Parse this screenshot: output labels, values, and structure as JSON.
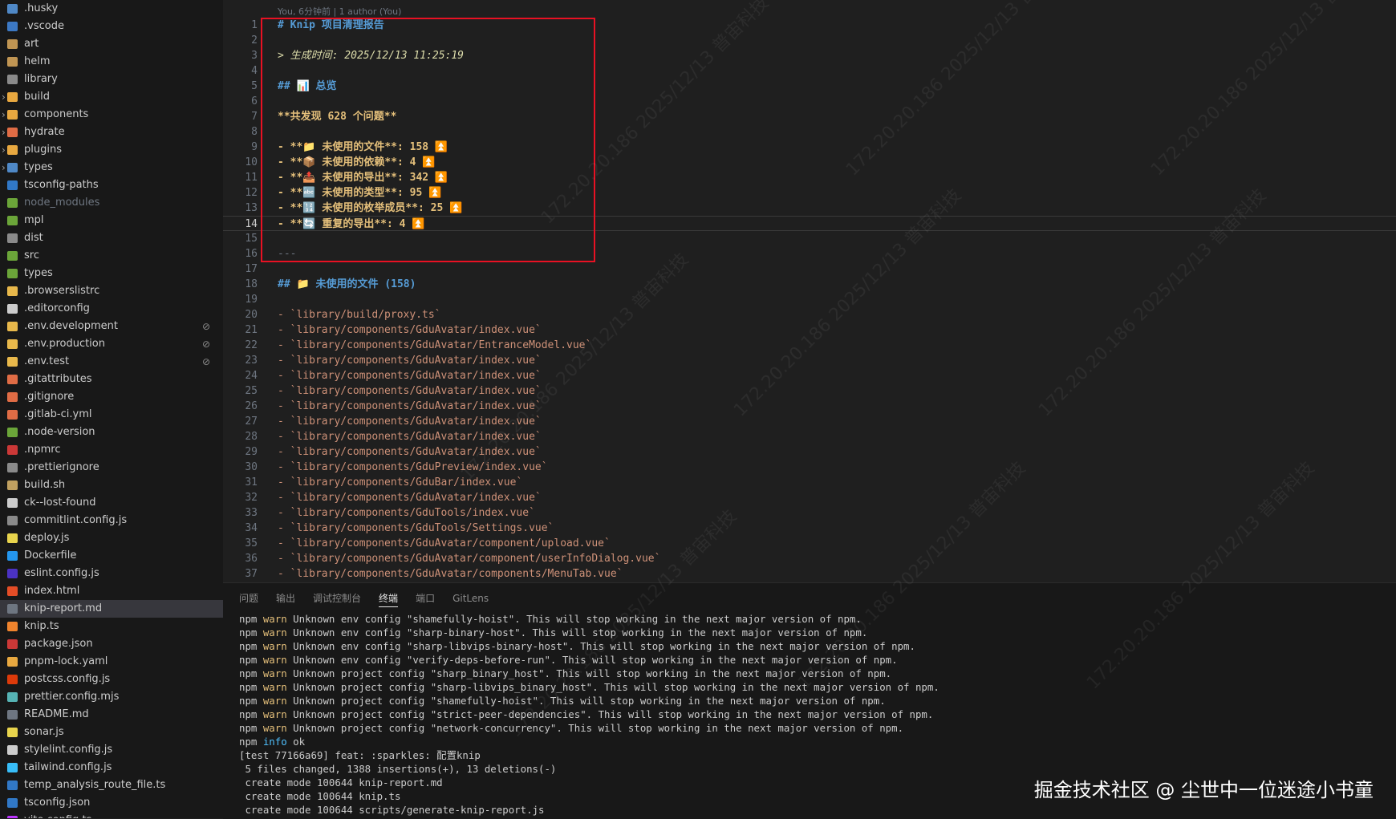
{
  "sidebar": {
    "items": [
      {
        "name": ".husky",
        "icon_color": "#4f88c6",
        "chevron": ""
      },
      {
        "name": ".vscode",
        "icon_color": "#3c78c3",
        "chevron": ""
      },
      {
        "name": "art",
        "icon_color": "#c09553",
        "chevron": ""
      },
      {
        "name": "helm",
        "icon_color": "#c09553",
        "chevron": ""
      },
      {
        "name": "library",
        "icon_color": "#8a8a8a",
        "chevron": ""
      },
      {
        "name": "build",
        "icon_color": "#e8a840",
        "chevron": "›"
      },
      {
        "name": "components",
        "icon_color": "#e8a840",
        "chevron": "›"
      },
      {
        "name": "hydrate",
        "icon_color": "#e06c45",
        "chevron": "›"
      },
      {
        "name": "plugins",
        "icon_color": "#e8a840",
        "chevron": "›"
      },
      {
        "name": "types",
        "icon_color": "#4f88c6",
        "chevron": "›"
      },
      {
        "name": "tsconfig-paths",
        "icon_color": "#3178c6",
        "chevron": ""
      },
      {
        "name": "node_modules",
        "icon_color": "#6ba539",
        "chevron": "",
        "dim": true
      },
      {
        "name": "mpl",
        "icon_color": "#6ba539",
        "chevron": ""
      },
      {
        "name": "dist",
        "icon_color": "#8a8a8a",
        "chevron": ""
      },
      {
        "name": "src",
        "icon_color": "#6ba539",
        "chevron": ""
      },
      {
        "name": "types",
        "icon_color": "#6ba539",
        "chevron": ""
      },
      {
        "name": ".browserslistrc",
        "icon_color": "#e8b84b",
        "chevron": ""
      },
      {
        "name": ".editorconfig",
        "icon_color": "#cccccc",
        "chevron": ""
      },
      {
        "name": ".env.development",
        "icon_color": "#e8b84b",
        "chevron": "",
        "badge": "⊘"
      },
      {
        "name": ".env.production",
        "icon_color": "#e8b84b",
        "chevron": "",
        "badge": "⊘"
      },
      {
        "name": ".env.test",
        "icon_color": "#e8b84b",
        "chevron": "",
        "badge": "⊘"
      },
      {
        "name": ".gitattributes",
        "icon_color": "#e06c45",
        "chevron": ""
      },
      {
        "name": ".gitignore",
        "icon_color": "#e06c45",
        "chevron": ""
      },
      {
        "name": ".gitlab-ci.yml",
        "icon_color": "#e06c45",
        "chevron": ""
      },
      {
        "name": ".node-version",
        "icon_color": "#6ba539",
        "chevron": ""
      },
      {
        "name": ".npmrc",
        "icon_color": "#cb3837",
        "chevron": ""
      },
      {
        "name": ".prettierignore",
        "icon_color": "#8a8a8a",
        "chevron": ""
      },
      {
        "name": "build.sh",
        "icon_color": "#c0a060",
        "chevron": ""
      },
      {
        "name": "ck--lost-found",
        "icon_color": "#cccccc",
        "chevron": ""
      },
      {
        "name": "commitlint.config.js",
        "icon_color": "#8a8a8a",
        "chevron": ""
      },
      {
        "name": "deploy.js",
        "icon_color": "#e8d44d",
        "chevron": ""
      },
      {
        "name": "Dockerfile",
        "icon_color": "#2496ed",
        "chevron": ""
      },
      {
        "name": "eslint.config.js",
        "icon_color": "#4b32c3",
        "chevron": ""
      },
      {
        "name": "index.html",
        "icon_color": "#e44d26",
        "chevron": ""
      },
      {
        "name": "knip-report.md",
        "icon_color": "#6e7681",
        "chevron": "",
        "active": true
      },
      {
        "name": "knip.ts",
        "icon_color": "#f0842d",
        "chevron": ""
      },
      {
        "name": "package.json",
        "icon_color": "#cb3837",
        "chevron": ""
      },
      {
        "name": "pnpm-lock.yaml",
        "icon_color": "#e8a840",
        "chevron": ""
      },
      {
        "name": "postcss.config.js",
        "icon_color": "#dd3a0a",
        "chevron": ""
      },
      {
        "name": "prettier.config.mjs",
        "icon_color": "#56b3b4",
        "chevron": ""
      },
      {
        "name": "README.md",
        "icon_color": "#6e7681",
        "chevron": ""
      },
      {
        "name": "sonar.js",
        "icon_color": "#e8d44d",
        "chevron": ""
      },
      {
        "name": "stylelint.config.js",
        "icon_color": "#cccccc",
        "chevron": ""
      },
      {
        "name": "tailwind.config.js",
        "icon_color": "#38bdf8",
        "chevron": ""
      },
      {
        "name": "temp_analysis_route_file.ts",
        "icon_color": "#3178c6",
        "chevron": ""
      },
      {
        "name": "tsconfig.json",
        "icon_color": "#3178c6",
        "chevron": ""
      },
      {
        "name": "vite.config.ts",
        "icon_color": "#bd34fe",
        "chevron": ""
      }
    ]
  },
  "editor": {
    "blame": "You, 6分钟前 | 1 author (You)",
    "lines": [
      {
        "n": "1",
        "text": "# Knip 项目清理报告",
        "cls": "c-head"
      },
      {
        "n": "2",
        "text": "",
        "cls": ""
      },
      {
        "n": "3",
        "text": "> 生成时间: 2025/12/13 11:25:19",
        "cls": "c-quote"
      },
      {
        "n": "4",
        "text": "",
        "cls": ""
      },
      {
        "n": "5",
        "text": "## 📊 总览",
        "cls": "c-head"
      },
      {
        "n": "6",
        "text": "",
        "cls": ""
      },
      {
        "n": "7",
        "text": "**共发现 628 个问题**",
        "cls": "c-bold"
      },
      {
        "n": "8",
        "text": "",
        "cls": ""
      },
      {
        "n": "9",
        "text": "- **📁 未使用的文件**: 158 ⏫",
        "cls": "c-bold"
      },
      {
        "n": "10",
        "text": "- **📦 未使用的依赖**: 4 ⏫",
        "cls": "c-bold"
      },
      {
        "n": "11",
        "text": "- **📤 未使用的导出**: 342 ⏫",
        "cls": "c-bold"
      },
      {
        "n": "12",
        "text": "- **🔤 未使用的类型**: 95 ⏫",
        "cls": "c-bold"
      },
      {
        "n": "13",
        "text": "- **🔢 未使用的枚举成员**: 25 ⏫",
        "cls": "c-bold"
      },
      {
        "n": "14",
        "text": "- **🔄 重复的导出**: 4 ⏫",
        "cls": "c-bold",
        "current": true
      },
      {
        "n": "15",
        "text": "",
        "cls": ""
      },
      {
        "n": "16",
        "text": "---",
        "cls": "c-hr"
      },
      {
        "n": "17",
        "text": "",
        "cls": ""
      },
      {
        "n": "18",
        "text": "## 📁 未使用的文件 (158)",
        "cls": "c-head"
      },
      {
        "n": "19",
        "text": "",
        "cls": ""
      },
      {
        "n": "20",
        "text": "- `library/build/proxy.ts`",
        "cls": "c-str"
      },
      {
        "n": "21",
        "text": "- `library/components/GduAvatar/index.vue`",
        "cls": "c-str"
      },
      {
        "n": "22",
        "text": "- `library/components/GduAvatar/EntranceModel.vue`",
        "cls": "c-str"
      },
      {
        "n": "23",
        "text": "- `library/components/GduAvatar/index.vue`",
        "cls": "c-str"
      },
      {
        "n": "24",
        "text": "- `library/components/GduAvatar/index.vue`",
        "cls": "c-str"
      },
      {
        "n": "25",
        "text": "- `library/components/GduAvatar/index.vue`",
        "cls": "c-str"
      },
      {
        "n": "26",
        "text": "- `library/components/GduAvatar/index.vue`",
        "cls": "c-str"
      },
      {
        "n": "27",
        "text": "- `library/components/GduAvatar/index.vue`",
        "cls": "c-str"
      },
      {
        "n": "28",
        "text": "- `library/components/GduAvatar/index.vue`",
        "cls": "c-str"
      },
      {
        "n": "29",
        "text": "- `library/components/GduAvatar/index.vue`",
        "cls": "c-str"
      },
      {
        "n": "30",
        "text": "- `library/components/GduPreview/index.vue`",
        "cls": "c-str"
      },
      {
        "n": "31",
        "text": "- `library/components/GduBar/index.vue`",
        "cls": "c-str"
      },
      {
        "n": "32",
        "text": "- `library/components/GduAvatar/index.vue`",
        "cls": "c-str"
      },
      {
        "n": "33",
        "text": "- `library/components/GduTools/index.vue`",
        "cls": "c-str"
      },
      {
        "n": "34",
        "text": "- `library/components/GduTools/Settings.vue`",
        "cls": "c-str"
      },
      {
        "n": "35",
        "text": "- `library/components/GduAvatar/component/upload.vue`",
        "cls": "c-str"
      },
      {
        "n": "36",
        "text": "- `library/components/GduAvatar/component/userInfoDialog.vue`",
        "cls": "c-str"
      },
      {
        "n": "37",
        "text": "- `library/components/GduAvatar/components/MenuTab.vue`",
        "cls": "c-str"
      }
    ]
  },
  "panel": {
    "tabs": [
      {
        "label": "问题",
        "active": false
      },
      {
        "label": "输出",
        "active": false
      },
      {
        "label": "调试控制台",
        "active": false
      },
      {
        "label": "终端",
        "active": true
      },
      {
        "label": "端口",
        "active": false
      },
      {
        "label": "GitLens",
        "active": false
      }
    ],
    "terminal": [
      {
        "p": "npm ",
        "k": "warn",
        "kc": "t-warn",
        "r": " Unknown env config \"shamefully-hoist\". This will stop working in the next major version of npm."
      },
      {
        "p": "npm ",
        "k": "warn",
        "kc": "t-warn",
        "r": " Unknown env config \"sharp-binary-host\". This will stop working in the next major version of npm."
      },
      {
        "p": "npm ",
        "k": "warn",
        "kc": "t-warn",
        "r": " Unknown env config \"sharp-libvips-binary-host\". This will stop working in the next major version of npm."
      },
      {
        "p": "npm ",
        "k": "warn",
        "kc": "t-warn",
        "r": " Unknown env config \"verify-deps-before-run\". This will stop working in the next major version of npm."
      },
      {
        "p": "npm ",
        "k": "warn",
        "kc": "t-warn",
        "r": " Unknown project config \"sharp_binary_host\". This will stop working in the next major version of npm."
      },
      {
        "p": "npm ",
        "k": "warn",
        "kc": "t-warn",
        "r": " Unknown project config \"sharp-libvips_binary_host\". This will stop working in the next major version of npm."
      },
      {
        "p": "npm ",
        "k": "warn",
        "kc": "t-warn",
        "r": " Unknown project config \"shamefully-hoist\". This will stop working in the next major version of npm."
      },
      {
        "p": "npm ",
        "k": "warn",
        "kc": "t-warn",
        "r": " Unknown project config \"strict-peer-dependencies\". This will stop working in the next major version of npm."
      },
      {
        "p": "npm ",
        "k": "warn",
        "kc": "t-warn",
        "r": " Unknown project config \"network-concurrency\". This will stop working in the next major version of npm."
      },
      {
        "p": "npm ",
        "k": "info",
        "kc": "t-info",
        "r": " ok"
      },
      {
        "p": "[test 77166a69] feat: :sparkles: 配置knip",
        "k": "",
        "kc": "",
        "r": ""
      },
      {
        "p": " 5 files changed, 1388 insertions(+), 13 deletions(-)",
        "k": "",
        "kc": "",
        "r": ""
      },
      {
        "p": " create mode 100644 knip-report.md",
        "k": "",
        "kc": "",
        "r": ""
      },
      {
        "p": " create mode 100644 knip.ts",
        "k": "",
        "kc": "",
        "r": ""
      },
      {
        "p": " create mode 100644 scripts/generate-knip-report.js",
        "k": "",
        "kc": "",
        "r": ""
      }
    ]
  },
  "watermark": {
    "ip": "172.20.20.186",
    "date": "2025/12/13",
    "org": "普宙科技"
  },
  "credit": "掘金技术社区 @ 尘世中一位迷途小书童"
}
